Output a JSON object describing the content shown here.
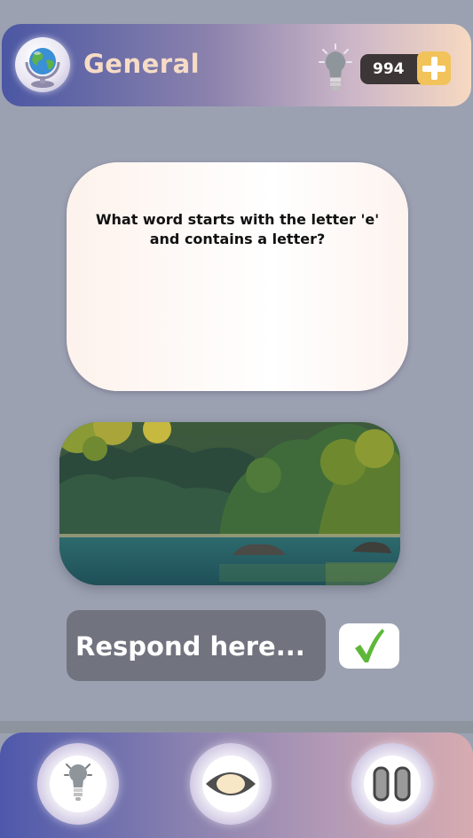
{
  "header": {
    "category_title": "General",
    "coins": "994",
    "icons": {
      "category": "globe-icon",
      "hint": "lightbulb-icon",
      "add": "plus-icon"
    }
  },
  "question": {
    "text": "What word starts with the letter 'e' and contains a letter?"
  },
  "image": {
    "subject": "lake-forest-photo"
  },
  "answer": {
    "placeholder": "Respond here...",
    "value": "",
    "submit_icon": "checkmark-icon"
  },
  "bottom_bar": {
    "buttons": [
      {
        "icon": "lightbulb-icon"
      },
      {
        "icon": "eye-icon"
      },
      {
        "icon": "pause-icon"
      }
    ]
  },
  "colors": {
    "background": "#9ba1b1",
    "title": "#f6dcc6",
    "coin_badge": "#3c3636",
    "plus": "#f2c35a",
    "check": "#5db83a",
    "answer_field": "#71747f"
  }
}
